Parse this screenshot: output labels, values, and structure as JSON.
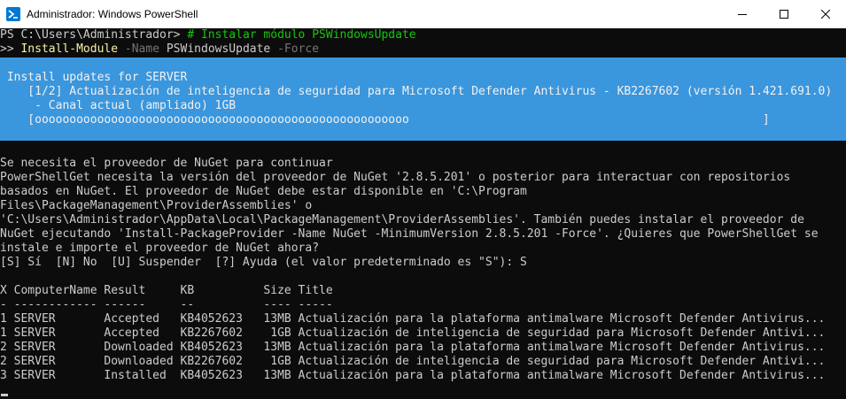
{
  "window": {
    "title": "Administrador: Windows PowerShell"
  },
  "prompt": {
    "prefix": "PS C:\\Users\\Administrador> ",
    "comment": "# Instalar módulo PSWindowsUpdate",
    "continuation": ">> ",
    "cmdlet": "Install-Module",
    "param1": " -Name",
    "arg1": " PSWindowsUpdate",
    "param2": " -Force"
  },
  "progress": {
    "heading": " Install updates for SERVER",
    "activity": "    [1/2] Actualización de inteligencia de seguridad para Microsoft Defender Antivirus - KB2267602 (versión 1.421.691.0)",
    "status": "     - Canal actual (ampliado) 1GB",
    "bar": "    [oooooooooooooooooooooooooooooooooooooooooooooooooooooo                                                   ]"
  },
  "nuget_prompt": {
    "title": "Se necesita el proveedor de NuGet para continuar",
    "lines": [
      "PowerShellGet necesita la versión del proveedor de NuGet '2.8.5.201' o posterior para interactuar con repositorios",
      "basados en NuGet. El proveedor de NuGet debe estar disponible en 'C:\\Program",
      "Files\\PackageManagement\\ProviderAssemblies' o",
      "'C:\\Users\\Administrador\\AppData\\Local\\PackageManagement\\ProviderAssemblies'. También puedes instalar el proveedor de",
      "NuGet ejecutando 'Install-PackageProvider -Name NuGet -MinimumVersion 2.8.5.201 -Force'. ¿Quieres que PowerShellGet se",
      "instale e importe el proveedor de NuGet ahora?"
    ],
    "choice_line": "[S] Sí  [N] No  [U] Suspender  [?] Ayuda (el valor predeterminado es \"S\"): S"
  },
  "table": {
    "header": "X ComputerName Result     KB          Size Title",
    "separator": "- ------------ ------     --          ---- -----",
    "rows": [
      "1 SERVER       Accepted   KB4052623   13MB Actualización para la plataforma antimalware Microsoft Defender Antivirus...",
      "1 SERVER       Accepted   KB2267602    1GB Actualización de inteligencia de seguridad para Microsoft Defender Antivi...",
      "2 SERVER       Downloaded KB4052623   13MB Actualización para la plataforma antimalware Microsoft Defender Antivirus...",
      "2 SERVER       Downloaded KB2267602    1GB Actualización de inteligencia de seguridad para Microsoft Defender Antivi...",
      "3 SERVER       Installed  KB4052623   13MB Actualización para la plataforma antimalware Microsoft Defender Antivirus..."
    ]
  },
  "colors": {
    "console_bg": "#0c0c0c",
    "console_fg": "#cccccc",
    "progress_bg": "#3a96dd",
    "command_yellow": "#f9f1a5",
    "comment_green": "#16c60c",
    "parameter_gray": "#767676"
  },
  "icons": {
    "app": "powershell-icon",
    "minimize": "minimize-icon",
    "maximize": "maximize-icon",
    "close": "close-icon"
  }
}
